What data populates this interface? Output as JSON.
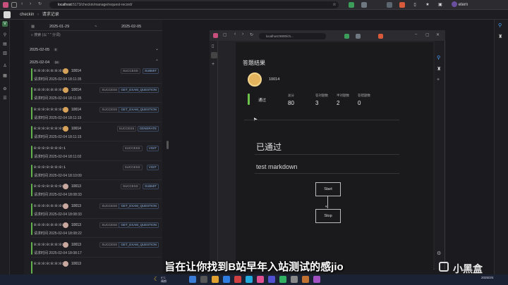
{
  "outer_browser": {
    "url_host": "localhost",
    "url_path": ":5173/checkin/manage/request-record/",
    "profile_name": "etern"
  },
  "app": {
    "name": "checkin",
    "breadcrumb": "请求记录"
  },
  "filter": {
    "date_start": "2025-01-29",
    "date_sep": "~",
    "date_end": "2025-02-05",
    "search_label": "搜索 (以 \" \" 分词)"
  },
  "groups": [
    {
      "date": "2025-02-05",
      "count": "0"
    },
    {
      "date": "2025-02-04",
      "count": "16"
    }
  ],
  "records": [
    {
      "ip": "0:0:0:0:0:0:0:1",
      "user": "10014",
      "status": "SUCCESS",
      "action": "SUBMIT",
      "time_label": "请求时间",
      "time": "2025-02-04 18:11:35",
      "avatar": "a"
    },
    {
      "ip": "0:0:0:0:0:0:0:1",
      "user": "10014",
      "status": "SUCCESS",
      "action": "GET_EXAM_QUESTION",
      "time_label": "请求时间",
      "time": "2025-02-04 18:11:35",
      "avatar": "a"
    },
    {
      "ip": "0:0:0:0:0:0:0:1",
      "user": "10014",
      "status": "SUCCESS",
      "action": "GET_EXAM_QUESTION",
      "time_label": "请求时间",
      "time": "2025-02-04 18:11:15",
      "avatar": "a"
    },
    {
      "ip": "0:0:0:0:0:0:0:1",
      "user": "10014",
      "status": "SUCCESS",
      "action": "GENERATE",
      "time_label": "请求时间",
      "time": "2025-02-04 18:11:15",
      "avatar": "a"
    },
    {
      "ip": "0:0:0:0:0:0:0:1",
      "user": "",
      "status": "SUCCESS",
      "action": "VISIT",
      "time_label": "请求时间",
      "time": "2025-02-04 18:11:02",
      "avatar": ""
    },
    {
      "ip": "0:0:0:0:0:0:0:1",
      "user": "",
      "status": "SUCCESS",
      "action": "VISIT",
      "time_label": "请求时间",
      "time": "2025-02-04 18:10:09",
      "avatar": ""
    },
    {
      "ip": "0:0:0:0:0:0:0:1",
      "user": "10013",
      "status": "SUCCESS",
      "action": "SUBMIT",
      "time_label": "请求时间",
      "time": "2025-02-04 18:08:33",
      "avatar": "b"
    },
    {
      "ip": "0:0:0:0:0:0:0:1",
      "user": "10013",
      "status": "SUCCESS",
      "action": "GET_EXAM_QUESTION",
      "time_label": "请求时间",
      "time": "2025-02-04 18:08:33",
      "avatar": "b"
    },
    {
      "ip": "0:0:0:0:0:0:0:1",
      "user": "10013",
      "status": "SUCCESS",
      "action": "GET_EXAM_QUESTION",
      "time_label": "请求时间",
      "time": "2025-02-04 18:08:22",
      "avatar": "b"
    },
    {
      "ip": "0:0:0:0:0:0:0:1",
      "user": "10013",
      "status": "SUCCESS",
      "action": "GET_EXAM_QUESTION",
      "time_label": "请求时间",
      "time": "2025-02-04 18:08:17",
      "avatar": "b"
    },
    {
      "ip": "0:0:0:0:0:0:0:1",
      "user": "10013",
      "status": "",
      "action": "",
      "time_label": "",
      "time": "",
      "avatar": "b"
    }
  ],
  "inner_browser": {
    "url": "localhost:9000/ch..."
  },
  "result": {
    "title": "答题结果",
    "user": "10014",
    "pass_label": "通过",
    "stats": [
      {
        "label": "总分",
        "value": "80"
      },
      {
        "label": "答对题数",
        "value": "3"
      },
      {
        "label": "半对题数",
        "value": "2"
      },
      {
        "label": "答错题数",
        "value": "0"
      }
    ],
    "passed_heading": "已通过",
    "markdown_text": "test markdown",
    "flow": {
      "start": "Start",
      "stop": "Stop"
    }
  },
  "taskbar": {
    "weather_temp": "9°C",
    "weather_desc": "晴朗",
    "date": "2025/2/4"
  },
  "subtitle": "旨在让你找到B站早年入站测试的感jio",
  "watermark": "小黑盒",
  "colors": {
    "success_green": "#62b34e",
    "accent_blue": "#8fb4e3"
  }
}
